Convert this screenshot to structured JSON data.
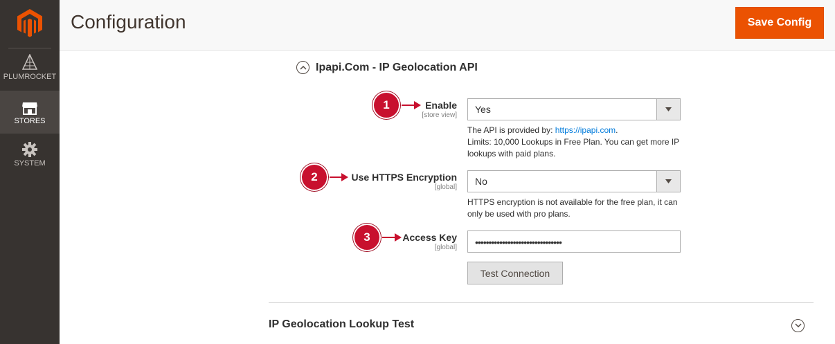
{
  "sidebar": {
    "items": [
      {
        "label": "PLUMROCKET",
        "icon": "plumrocket-icon"
      },
      {
        "label": "STORES",
        "icon": "store-icon"
      },
      {
        "label": "SYSTEM",
        "icon": "gear-icon"
      }
    ]
  },
  "header": {
    "title": "Configuration",
    "save_label": "Save Config"
  },
  "section": {
    "title": "Ipapi.Com - IP Geolocation API"
  },
  "fields": {
    "enable": {
      "label": "Enable",
      "scope": "[store view]",
      "value": "Yes",
      "note_prefix": "The API is provided by: ",
      "note_link": "https://ipapi.com",
      "note_suffix": ".",
      "note_line2": "Limits: 10,000 Lookups in Free Plan. You can get more IP lookups with paid plans."
    },
    "https": {
      "label": "Use HTTPS Encryption",
      "scope": "[global]",
      "value": "No",
      "note": "HTTPS encryption is not available for the free plan, it can only be used with pro plans."
    },
    "access_key": {
      "label": "Access Key",
      "scope": "[global]",
      "value": "••••••••••••••••••••••••••••••••"
    },
    "test_label": "Test Connection"
  },
  "badges": [
    "1",
    "2",
    "3"
  ],
  "lookup": {
    "title": "IP Geolocation Lookup Test"
  },
  "colors": {
    "accent": "#eb5202",
    "badge": "#c8102e",
    "sidebar": "#373330",
    "link": "#007bdb"
  }
}
